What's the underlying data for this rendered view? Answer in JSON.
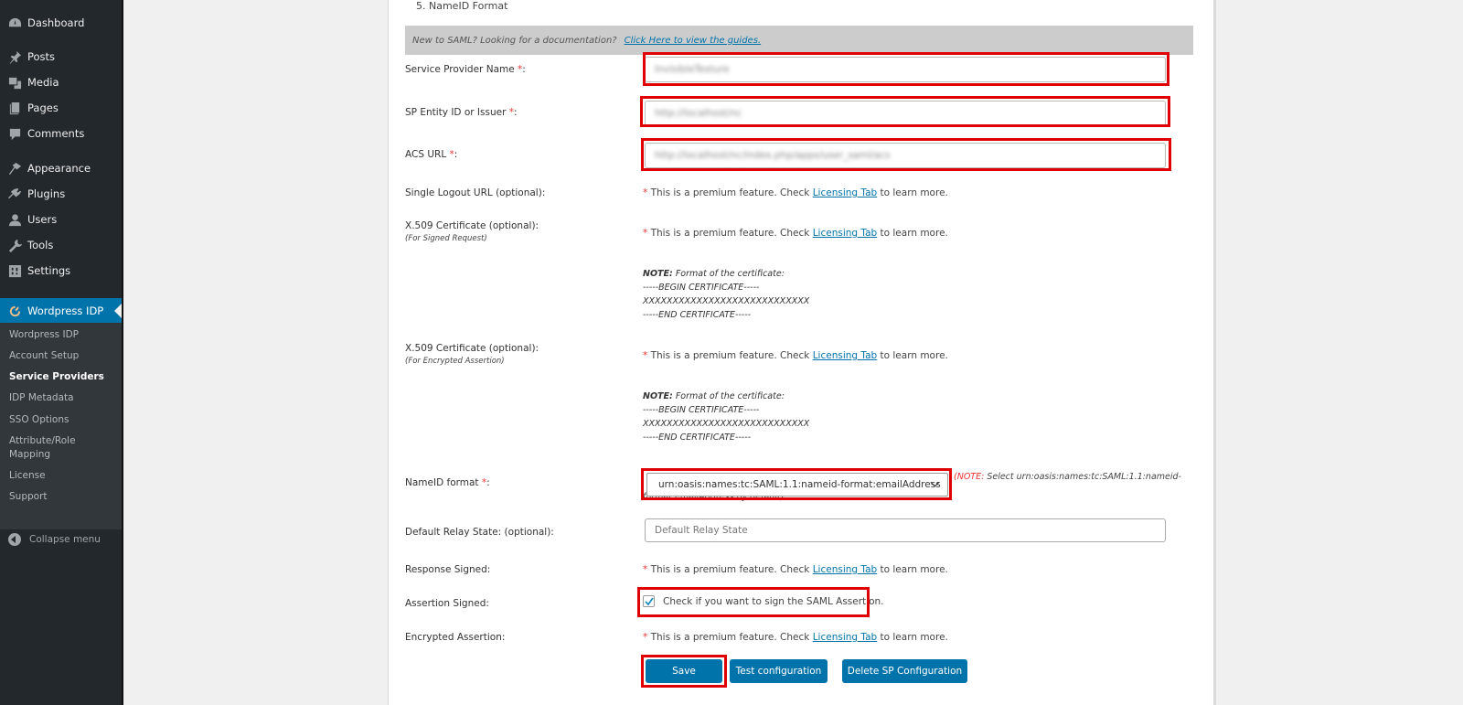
{
  "sidebar": {
    "items": [
      {
        "label": "Dashboard",
        "icon": "dashboard-icon"
      },
      {
        "label": "Posts",
        "icon": "pin-icon"
      },
      {
        "label": "Media",
        "icon": "media-icon"
      },
      {
        "label": "Pages",
        "icon": "pages-icon"
      },
      {
        "label": "Comments",
        "icon": "comment-icon"
      },
      {
        "label": "Appearance",
        "icon": "paintbrush-icon"
      },
      {
        "label": "Plugins",
        "icon": "plug-icon"
      },
      {
        "label": "Users",
        "icon": "user-icon"
      },
      {
        "label": "Tools",
        "icon": "wrench-icon"
      },
      {
        "label": "Settings",
        "icon": "settings-icon"
      },
      {
        "label": "Wordpress IDP",
        "icon": "idp-logo-icon",
        "active": true
      }
    ],
    "submenu": [
      {
        "label": "Wordpress IDP"
      },
      {
        "label": "Account Setup"
      },
      {
        "label": "Service Providers",
        "current": true
      },
      {
        "label": "IDP Metadata"
      },
      {
        "label": "SSO Options"
      },
      {
        "label": "Attribute/Role\nMapping"
      },
      {
        "label": "License"
      },
      {
        "label": "Support"
      }
    ],
    "collapse_label": "Collapse menu"
  },
  "main": {
    "step_label": "5. NameID Format",
    "doc_bar": {
      "text": "New to SAML?  Looking for a documentation?",
      "link": "Click Here to view the guides."
    },
    "fields": {
      "sp_name": {
        "label": "Service Provider Name ",
        "required": "*",
        "suffix": ":",
        "value": "InvisibleTexture"
      },
      "sp_entity": {
        "label": "SP Entity ID or Issuer ",
        "required": "*",
        "suffix": ":",
        "value": "http://localhost/nc"
      },
      "acs_url": {
        "label": "ACS URL ",
        "required": "*",
        "suffix": ":",
        "value": "http://localhost/nc/index.php/apps/user_saml/acs"
      },
      "slo_url": {
        "label": "Single Logout URL (optional):"
      },
      "x509_signed": {
        "label": "X.509 Certificate (optional):",
        "sublabel": "(For Signed Request)"
      },
      "x509_encrypted": {
        "label": "X.509 Certificate (optional):",
        "sublabel": "(For Encrypted Assertion)"
      },
      "nameid": {
        "label": "NameID format ",
        "required": "*",
        "suffix": ":",
        "selected": "urn:oasis:names:tc:SAML:1.1:nameid-format:emailAddress"
      },
      "relay_state": {
        "label": "Default Relay State: (optional):",
        "placeholder": "Default Relay State"
      },
      "response_signed": {
        "label": "Response Signed:"
      },
      "assertion_signed": {
        "label": "Assertion Signed:",
        "checkbox_label": "Check if you want to sign the SAML Assertion.",
        "checked": true
      },
      "encrypted_assertion": {
        "label": "Encrypted Assertion:"
      }
    },
    "premium": {
      "star": "*",
      "text_before": " This is a premium feature. Check ",
      "link": "Licensing Tab",
      "text_after": " to learn more."
    },
    "cert_note": {
      "note_label": "NOTE:",
      "note_text": " Format of the certificate:",
      "begin": "-----BEGIN CERTIFICATE-----",
      "body": "XXXXXXXXXXXXXXXXXXXXXXXXXXXX",
      "end": "-----END CERTIFICATE-----"
    },
    "nameid_note": {
      "note_label": "(NOTE:",
      "text": " Select urn:oasis:names:tc:SAML:1.1:nameid-format:emailAddress by default)"
    },
    "buttons": {
      "save": "Save",
      "test": "Test configuration",
      "delete": "Delete SP Configuration"
    }
  },
  "colors": {
    "sidebar_bg": "#23282d",
    "submenu_bg": "#32373c",
    "accent": "#0073aa",
    "highlight": "#e00000",
    "required": "#e33333"
  }
}
